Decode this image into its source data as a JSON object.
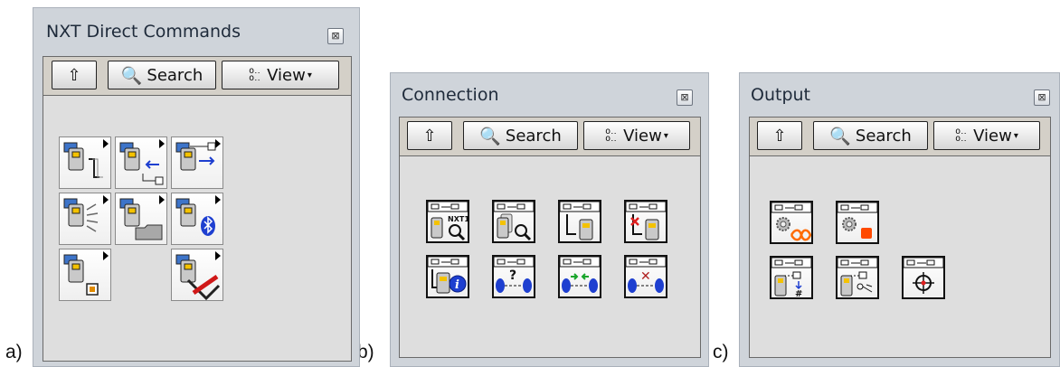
{
  "captions": {
    "a": "a)",
    "b": "b)",
    "c": "c)"
  },
  "palettes": [
    {
      "title": "NXT Direct Commands",
      "close": "⊠",
      "toolbar": {
        "up_glyph": "⇧",
        "search_label": "Search",
        "view_label": "View",
        "view_caret": "▾"
      },
      "icons": [
        "connect",
        "disconnect",
        "read",
        "broadcast",
        "file",
        "bluetooth",
        "output",
        "utility"
      ]
    },
    {
      "title": "Connection",
      "close": "⊠",
      "toolbar": {
        "up_glyph": "⇧",
        "search_label": "Search",
        "view_label": "View",
        "view_caret": "▾"
      },
      "icons": [
        "find-nxt",
        "find-all",
        "connect-usb",
        "disconnect-usb",
        "info",
        "bt-query",
        "bt-connect",
        "bt-disconnect"
      ],
      "icon_text": {
        "find_nxt": "NXT1",
        "bt_query": "?",
        "bt_disconnect": "✕"
      }
    },
    {
      "title": "Output",
      "close": "⊠",
      "toolbar": {
        "up_glyph": "⇧",
        "search_label": "Search",
        "view_label": "View",
        "view_caret": "▾"
      },
      "icons": [
        "motor-forever",
        "motor-stop",
        "output-read",
        "output-reset",
        "crosshair"
      ],
      "icon_text": {
        "output_read": "#"
      }
    }
  ],
  "colors": {
    "palette_bg": "#cfd4da",
    "inner_bg": "#dedede",
    "toolbar_bg": "#d4d0c8",
    "blue": "#1e3fd0",
    "red": "#e02020",
    "orange": "#ff6a00"
  }
}
